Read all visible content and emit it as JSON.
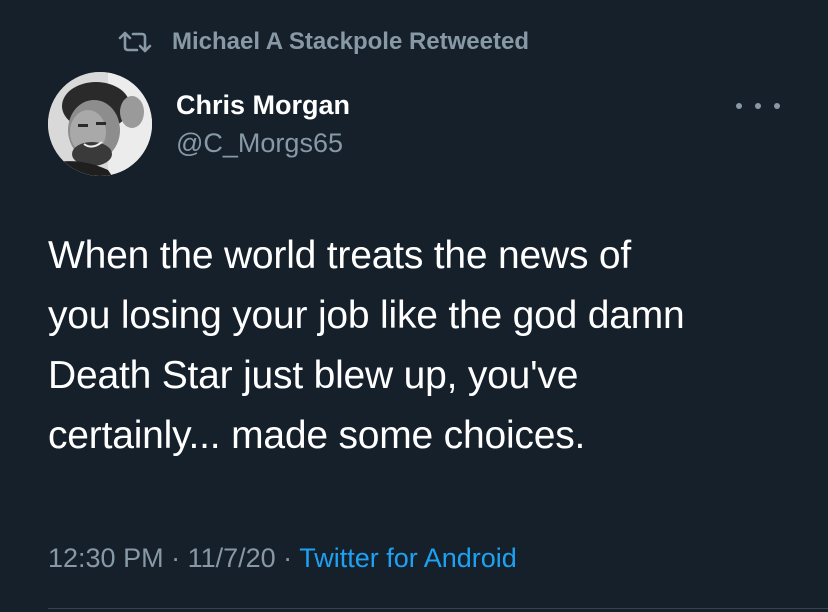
{
  "retweet": {
    "icon": "retweet-icon",
    "text": "Michael A Stackpole Retweeted"
  },
  "author": {
    "name": "Chris Morgan",
    "handle": "@C_Morgs65",
    "avatar_icon": "avatar-photo"
  },
  "more_icon": "more-horizontal-icon",
  "tweet": {
    "lines": [
      "When the world treats the news of",
      "you losing your job like the god damn",
      "Death Star just blew up, you've",
      "certainly... made some choices."
    ]
  },
  "meta": {
    "time": "12:30 PM",
    "sep1": " · ",
    "date": "11/7/20",
    "sep2": " · ",
    "source": "Twitter for Android"
  },
  "colors": {
    "background": "#15202b",
    "secondary_text": "#8899a6",
    "link": "#1da1f2"
  }
}
